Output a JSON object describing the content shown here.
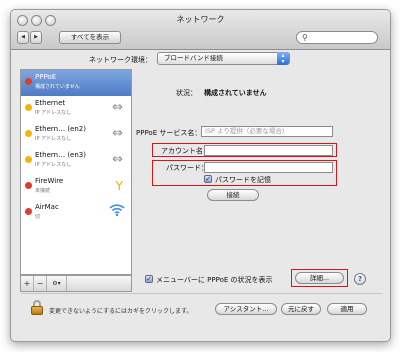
{
  "window": {
    "title": "ネットワーク"
  },
  "toolbar": {
    "back_label": "◀",
    "forward_label": "▶",
    "show_all_label": "すべてを表示",
    "search_placeholder": ""
  },
  "environment": {
    "label": "ネットワーク環境：",
    "selected": "ブロードバンド接続"
  },
  "services": [
    {
      "name": "PPPoE",
      "status": "構成されていません",
      "dot_color": "#e23b2e",
      "selected": true,
      "icon": ""
    },
    {
      "name": "Ethernet",
      "status": "IP アドレスなし",
      "dot_color": "#f2b705",
      "selected": false,
      "icon": "ethernet-arrows"
    },
    {
      "name": "Ethern… (en2)",
      "status": "IP アドレスなし",
      "dot_color": "#f2b705",
      "selected": false,
      "icon": "ethernet-arrows"
    },
    {
      "name": "Ethern… (en3)",
      "status": "IP アドレスなし",
      "dot_color": "#f2b705",
      "selected": false,
      "icon": "ethernet-arrows"
    },
    {
      "name": "FireWire",
      "status": "未接続",
      "dot_color": "#e23b2e",
      "selected": false,
      "icon": "firewire"
    },
    {
      "name": "AirMac",
      "status": "切",
      "dot_color": "#e23b2e",
      "selected": false,
      "icon": "wifi"
    }
  ],
  "sidebar_buttons": {
    "add": "+",
    "remove": "−",
    "action": "⚙▾"
  },
  "detail": {
    "status_label": "状況：",
    "status_value": "構成されていません",
    "service_name_label": "PPPoE サービス名：",
    "service_name_placeholder": "ISP より提供（必要な場合）",
    "account_label": "アカウント名：",
    "account_value": "",
    "password_label": "パスワード：",
    "password_value": "",
    "remember_password_label": "パスワードを記憶",
    "remember_password_checked": true,
    "connect_button": "接続",
    "menubar_label": "メニューバーに PPPoE の状況を表示",
    "menubar_checked": true,
    "details_button": "詳細...",
    "help_label": "?"
  },
  "footer": {
    "lock_text": "変更できないようにするにはカギをクリックします。",
    "assistant_button": "アシスタント...",
    "revert_button": "元に戻す",
    "apply_button": "適用"
  },
  "colors": {
    "selection": "#5a84cc",
    "highlight_box": "#d01818"
  }
}
